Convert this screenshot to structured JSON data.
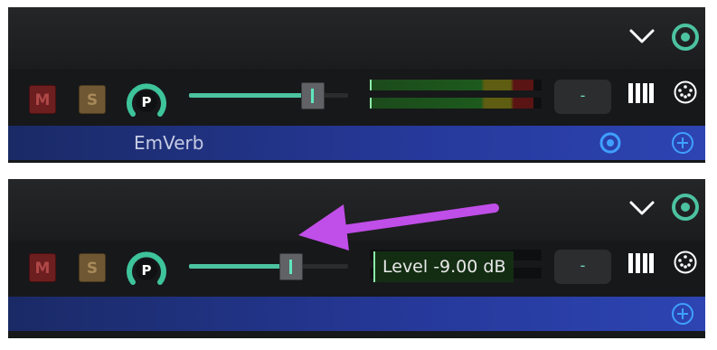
{
  "tracks": [
    {
      "mute_label": "M",
      "solo_label": "S",
      "pan_knob_label": "P",
      "pan_value": "-",
      "send_name": "EmVerb",
      "fader_level": 0.78,
      "meter_level": 0.95,
      "tooltip": ""
    },
    {
      "mute_label": "M",
      "solo_label": "S",
      "pan_knob_label": "P",
      "pan_value": "-",
      "send_name": "",
      "fader_level": 0.64,
      "meter_level": 0.0,
      "tooltip": "Level -9.00 dB"
    }
  ],
  "colors": {
    "accent": "#4cc2a0",
    "send_bar": "#26399b",
    "arrow": "#c04ee8",
    "mute": "#6d1e1e",
    "solo": "#6e5732"
  },
  "icons": [
    "chevron-down-icon",
    "target-icon",
    "piano-keys-icon",
    "midi-port-icon",
    "add-circle-icon"
  ]
}
